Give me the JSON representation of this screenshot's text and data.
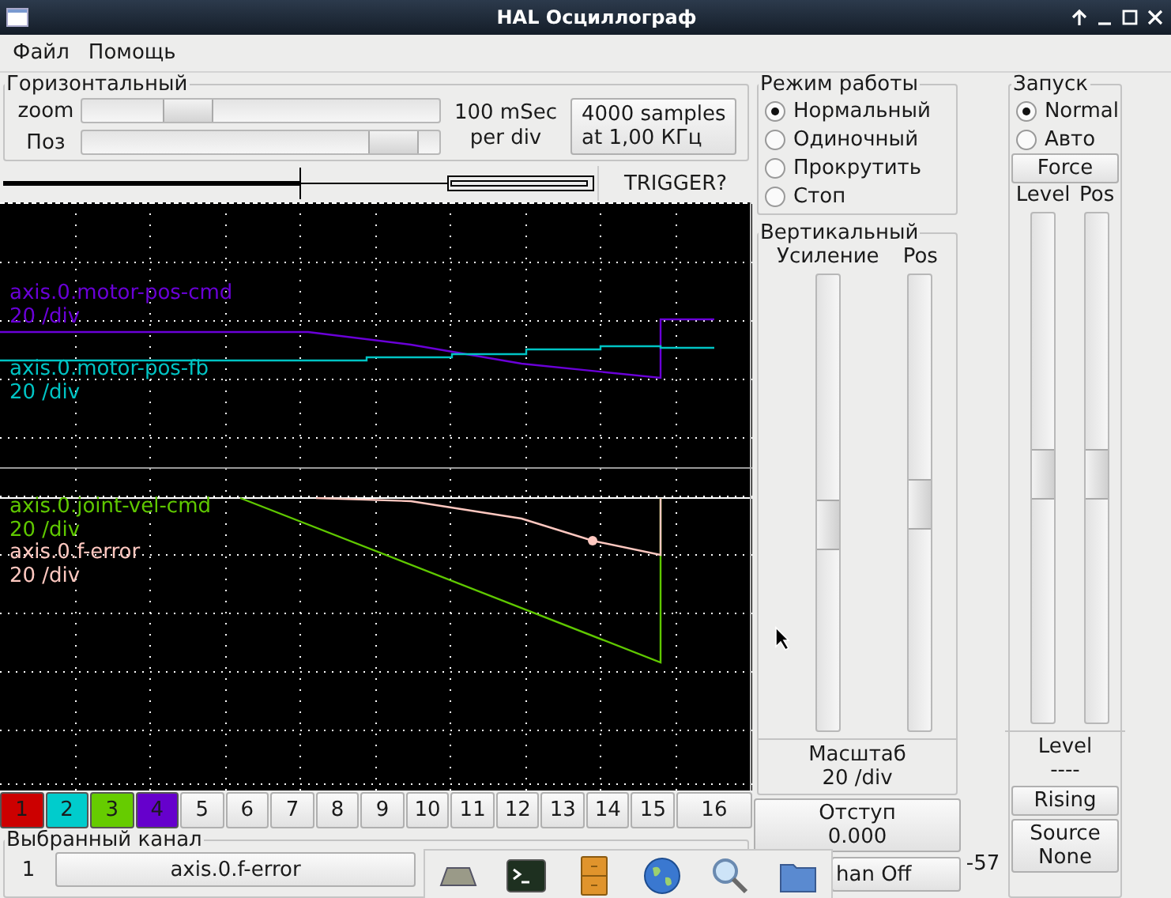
{
  "window": {
    "title": "HAL Осциллограф"
  },
  "menu": [
    "Файл",
    "Помощь"
  ],
  "horizontal": {
    "title": "Горизонтальный",
    "sliders": [
      {
        "label": "zoom",
        "level": 0.25
      },
      {
        "label": "Поз",
        "level": 0.89
      }
    ],
    "timebase": [
      "100 mSec",
      "per div"
    ],
    "samples_button": [
      "4000 samples",
      "at 1,00 КГц"
    ]
  },
  "trigger_button": "TRIGGER?",
  "traces": [
    {
      "name": "axis.0.motor-pos-cmd",
      "scale": "20 /div",
      "color": "#6a00d8"
    },
    {
      "name": "axis.0.motor-pos-fb",
      "scale": "20 /div",
      "color": "#00c4c4"
    },
    {
      "name": "axis.0.joint-vel-cmd",
      "scale": "20 /div",
      "color": "#5fc800"
    },
    {
      "name": "axis.0.f-error",
      "scale": "20 /div",
      "color": "#ffc8c0"
    }
  ],
  "channel_buttons": [
    {
      "label": "1",
      "color": "#cc0000"
    },
    {
      "label": "2",
      "color": "#00cccc"
    },
    {
      "label": "3",
      "color": "#66cc00"
    },
    {
      "label": "4",
      "color": "#6600cc"
    },
    {
      "label": "5"
    },
    {
      "label": "6"
    },
    {
      "label": "7"
    },
    {
      "label": "8"
    },
    {
      "label": "9"
    },
    {
      "label": "10"
    },
    {
      "label": "11"
    },
    {
      "label": "12"
    },
    {
      "label": "13"
    },
    {
      "label": "14"
    },
    {
      "label": "15"
    },
    {
      "label": "16"
    }
  ],
  "selected_channel": {
    "title": "Выбранный канал",
    "number": "1",
    "name": "axis.0.f-error"
  },
  "run_mode": {
    "title": "Режим работы",
    "options": [
      {
        "label": "Нормальный",
        "selected": true
      },
      {
        "label": "Одиночный",
        "selected": false
      },
      {
        "label": "Прокрутить",
        "selected": false
      },
      {
        "label": "Стоп",
        "selected": false
      }
    ]
  },
  "vertical": {
    "title": "Вертикальный",
    "sliders": [
      {
        "label": "Усиление",
        "level": 0.45
      },
      {
        "label": "Pos",
        "level": 0.5
      }
    ],
    "scale_label": "Масштаб",
    "scale_value": "20 /div",
    "offset_button": [
      "Отступ",
      "0.000"
    ],
    "chan_off_button": "han Off"
  },
  "readout": "-57",
  "trigger": {
    "title": "Запуск",
    "options": [
      {
        "label": "Normal",
        "selected": true
      },
      {
        "label": "Авто",
        "selected": false
      }
    ],
    "force_button": "Force",
    "sliders": [
      {
        "label": "Level",
        "level": 0.49
      },
      {
        "label": "Pos",
        "level": 0.49
      }
    ],
    "level_label": "Level",
    "level_value": "----",
    "edge_button": "Rising",
    "source_button": [
      "Source",
      "None"
    ]
  }
}
